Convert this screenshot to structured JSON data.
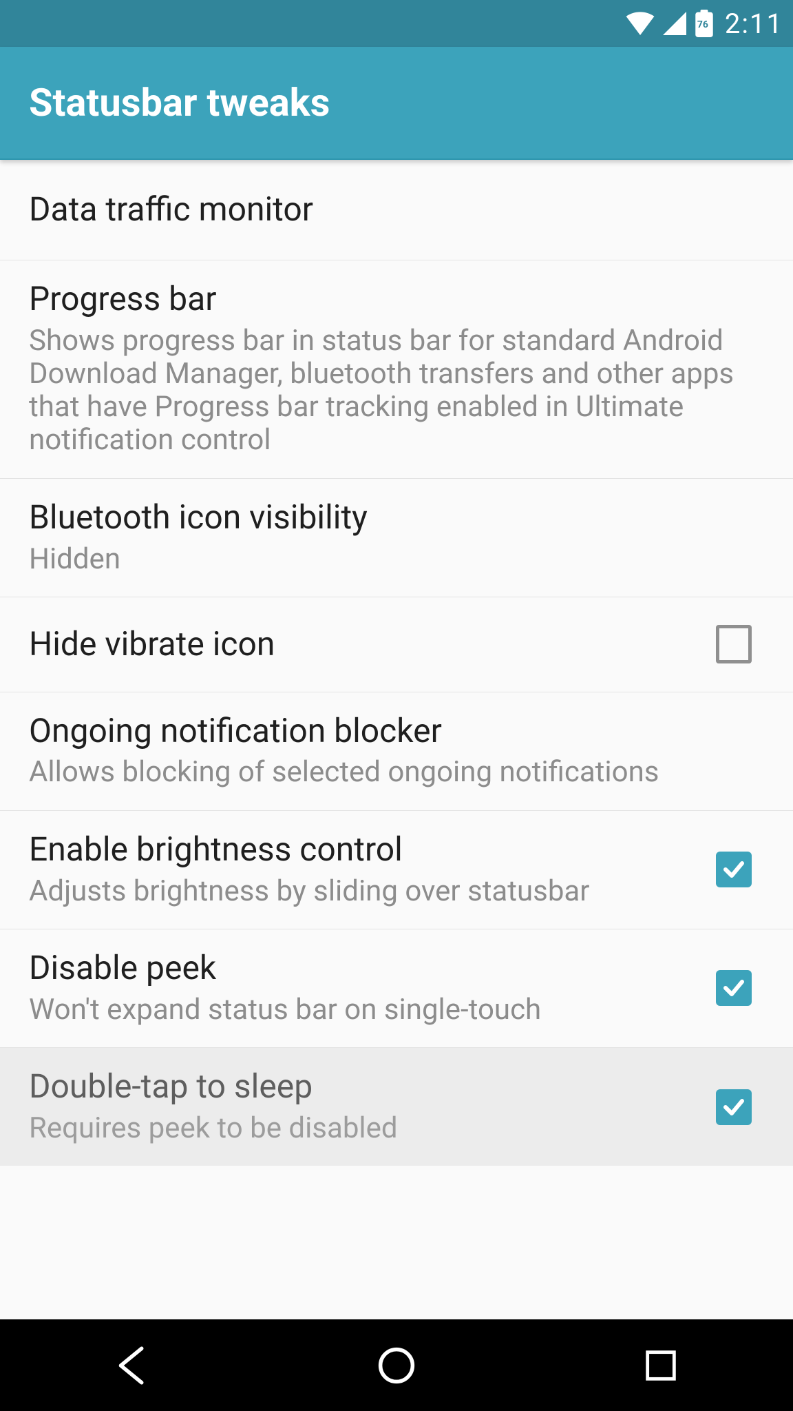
{
  "status": {
    "time": "2:11",
    "battery_percent": "76"
  },
  "appbar": {
    "title": "Statusbar tweaks"
  },
  "rows": {
    "data_traffic": {
      "title": "Data traffic monitor"
    },
    "progress_bar": {
      "title": "Progress bar",
      "sub": "Shows progress bar in status bar for standard Android Download Manager, bluetooth transfers and other apps that have Progress bar tracking enabled in Ultimate notification control"
    },
    "bt_visibility": {
      "title": "Bluetooth icon visibility",
      "sub": "Hidden"
    },
    "hide_vibrate": {
      "title": "Hide vibrate icon",
      "checked": false
    },
    "notif_blocker": {
      "title": "Ongoing notification blocker",
      "sub": "Allows blocking of selected ongoing notifications"
    },
    "brightness": {
      "title": "Enable brightness control",
      "sub": "Adjusts brightness by sliding over statusbar",
      "checked": true
    },
    "disable_peek": {
      "title": "Disable peek",
      "sub": "Won't expand status bar on single-touch",
      "checked": true
    },
    "double_tap": {
      "title": "Double-tap to sleep",
      "sub": "Requires peek to be disabled",
      "checked": true,
      "disabled": true
    }
  },
  "colors": {
    "statusbar_dark": "#31859a",
    "appbar": "#3ca3bb",
    "accent": "#3ca3bb",
    "text_primary": "#1f1f1f",
    "text_secondary": "#8c8c8c",
    "bg": "#fafafa"
  }
}
